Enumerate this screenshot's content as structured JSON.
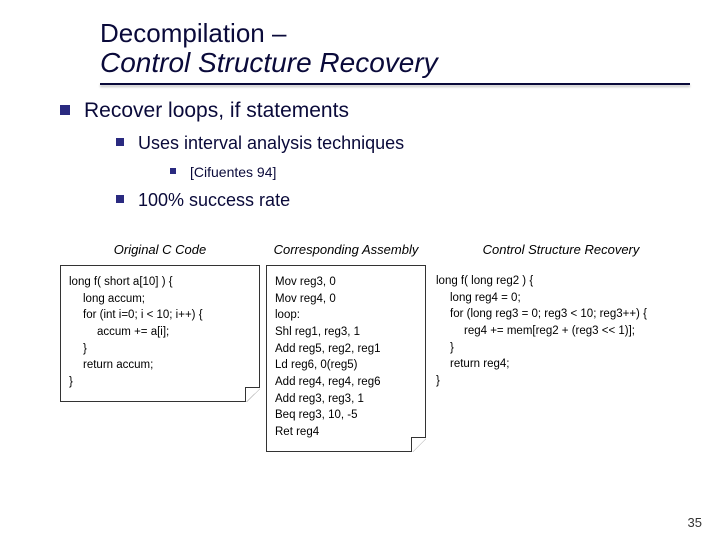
{
  "title": {
    "line1": "Decompilation –",
    "line2": "Control Structure Recovery"
  },
  "bullets": {
    "b1": "Recover loops, if statements",
    "b2a": "Uses interval analysis techniques",
    "b3": "[Cifuentes 94]",
    "b2b": "100% success rate"
  },
  "columns": {
    "c1_head": "Original C Code",
    "c2_head": "Corresponding Assembly",
    "c3_head": "Control Structure Recovery",
    "c1": {
      "l0": "long f( short a[10] ) {",
      "l1": "long accum;",
      "l2": "for (int i=0; i < 10; i++) {",
      "l3": "accum += a[i];",
      "l4": "}",
      "l5": "return accum;",
      "l6": "}"
    },
    "c2": {
      "l0": "Mov reg3, 0",
      "l1": "Mov reg4, 0",
      "l2": "loop:",
      "l3": "Shl reg1, reg3, 1",
      "l4": "Add reg5, reg2, reg1",
      "l5": "Ld reg6, 0(reg5)",
      "l6": "Add reg4, reg4, reg6",
      "l7": "Add reg3, reg3, 1",
      "l8": "Beq reg3, 10, -5",
      "l9": "Ret reg4"
    },
    "c3": {
      "l0": "long f( long reg2 ) {",
      "l1": "long reg4 = 0;",
      "l2": "for (long reg3 = 0; reg3 < 10; reg3++) {",
      "l3": "reg4 += mem[reg2 + (reg3 << 1)];",
      "l4": "}",
      "l5": "return reg4;",
      "l6": "}"
    }
  },
  "pagenum": "35"
}
